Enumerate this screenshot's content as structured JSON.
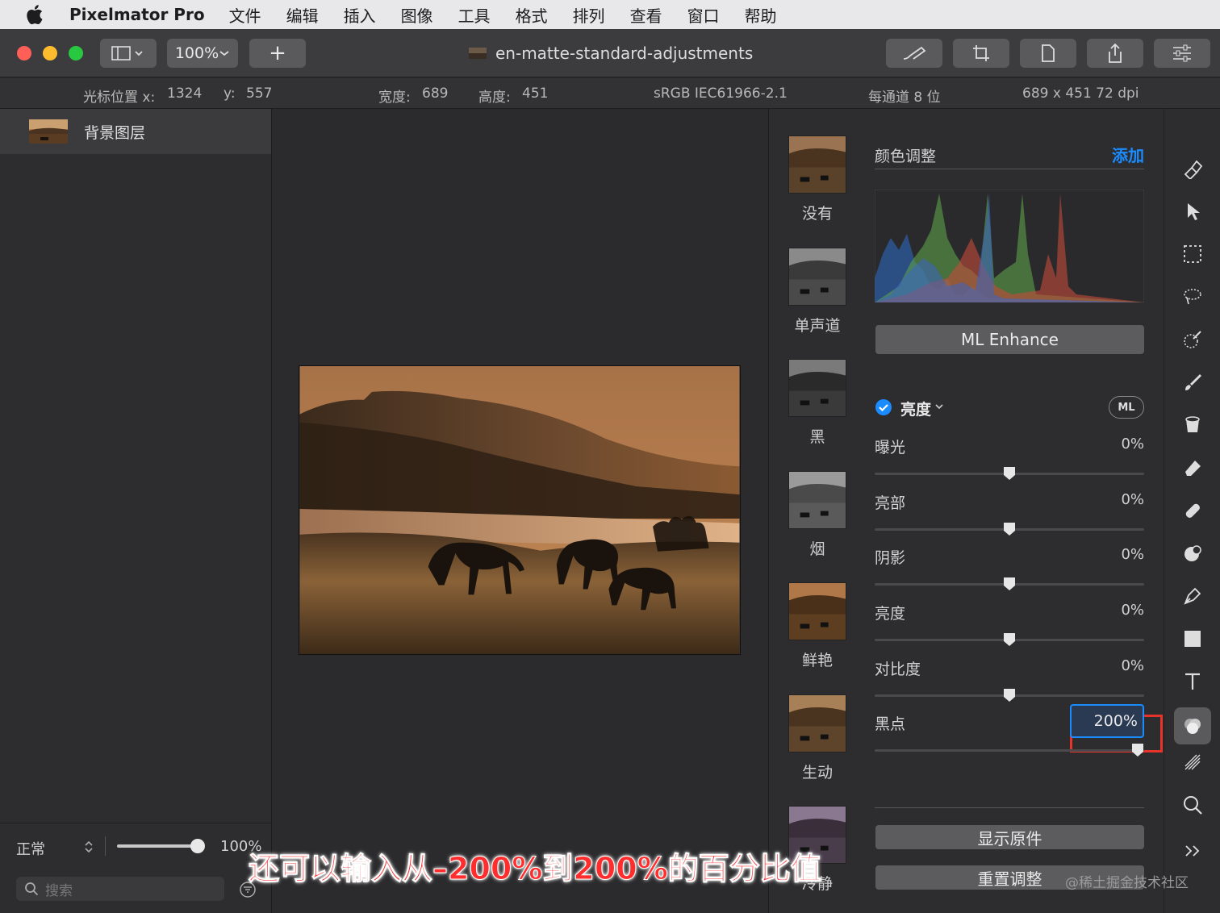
{
  "menubar": {
    "app_name": "Pixelmator Pro",
    "items": [
      "文件",
      "编辑",
      "插入",
      "图像",
      "工具",
      "格式",
      "排列",
      "查看",
      "窗口",
      "帮助"
    ]
  },
  "toolbar": {
    "zoom": "100%",
    "add": "+",
    "document_title": "en-matte-standard-adjustments"
  },
  "infobar": {
    "cursor_x_label": "光标位置 x:",
    "cursor_x": "1324",
    "cursor_y_label": "y:",
    "cursor_y": "557",
    "width_label": "宽度:",
    "width": "689",
    "height_label": "高度:",
    "height": "451",
    "color_profile": "sRGB IEC61966-2.1",
    "bit_depth": "每通道 8 位",
    "dimensions": "689 x 451 72 dpi"
  },
  "layers": {
    "background_layer": "背景图层",
    "blend_mode": "正常",
    "opacity": "100%",
    "opacity_fraction": 1.0,
    "search_placeholder": "搜索"
  },
  "presets": [
    "没有",
    "单声道",
    "黑",
    "烟",
    "鲜艳",
    "生动",
    "冷静"
  ],
  "adjust": {
    "section_title": "颜色调整",
    "add_link": "添加",
    "ml_enhance": "ML Enhance",
    "group_name": "亮度",
    "ml_badge": "ML",
    "sliders": [
      {
        "label": "曝光",
        "value": "0%"
      },
      {
        "label": "亮部",
        "value": "0%"
      },
      {
        "label": "阴影",
        "value": "0%"
      },
      {
        "label": "亮度",
        "value": "0%"
      },
      {
        "label": "对比度",
        "value": "0%"
      },
      {
        "label": "黑点",
        "value": "200%"
      }
    ],
    "show_original": "显示原件",
    "reset": "重置调整"
  },
  "colors": {
    "accent": "#1a8cff",
    "highlight_box": "#e8332b",
    "overlay_text": "#ff2d2d"
  },
  "overlay_caption": "还可以输入从–200%到200%的百分比值",
  "watermark": "@稀土掘金技术社区"
}
